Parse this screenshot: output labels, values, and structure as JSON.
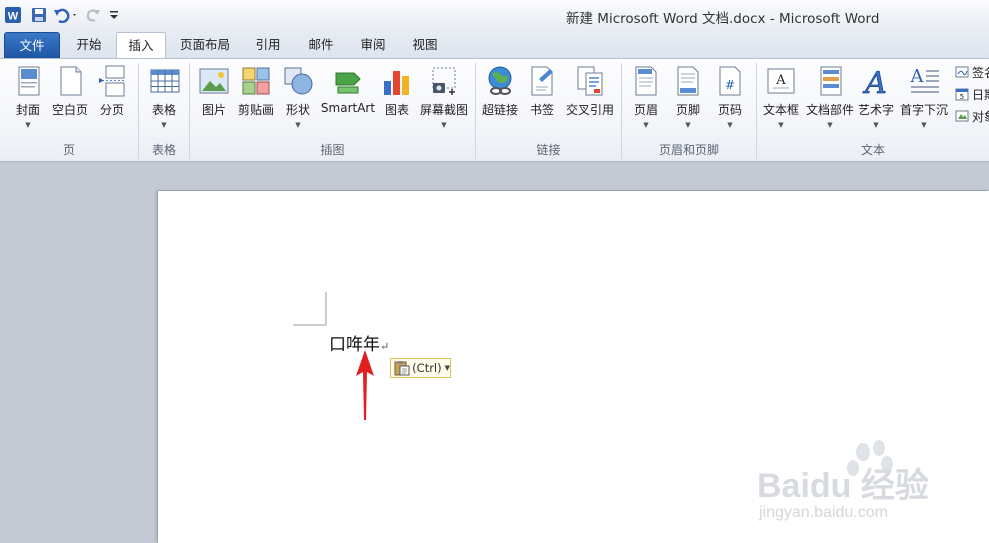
{
  "window": {
    "title": "新建 Microsoft Word 文档.docx  -  Microsoft Word"
  },
  "quick_access": {
    "icons": [
      "word-logo-icon",
      "save-icon",
      "undo-icon",
      "redo-icon",
      "customize-icon"
    ]
  },
  "tabs": [
    {
      "label": "文件"
    },
    {
      "label": "开始"
    },
    {
      "label": "插入"
    },
    {
      "label": "页面布局"
    },
    {
      "label": "引用"
    },
    {
      "label": "邮件"
    },
    {
      "label": "审阅"
    },
    {
      "label": "视图"
    }
  ],
  "ribbon": {
    "buttons": [
      {
        "label": "封面"
      },
      {
        "label": "空白页"
      },
      {
        "label": "分页"
      },
      {
        "label": "表格"
      },
      {
        "label": "图片"
      },
      {
        "label": "剪贴画"
      },
      {
        "label": "形状"
      },
      {
        "label": "SmartArt"
      },
      {
        "label": "图表"
      },
      {
        "label": "屏幕截图"
      },
      {
        "label": "超链接"
      },
      {
        "label": "书签"
      },
      {
        "label": "交叉引用"
      },
      {
        "label": "页眉"
      },
      {
        "label": "页脚"
      },
      {
        "label": "页码"
      },
      {
        "label": "文本框"
      },
      {
        "label": "文档部件"
      },
      {
        "label": "艺术字"
      },
      {
        "label": "首字下沉"
      }
    ],
    "small_buttons": [
      {
        "label": "签名"
      },
      {
        "label": "日期"
      },
      {
        "label": "对象"
      }
    ],
    "groups": [
      {
        "label": "页"
      },
      {
        "label": "表格"
      },
      {
        "label": "插图"
      },
      {
        "label": "链接"
      },
      {
        "label": "页眉和页脚"
      },
      {
        "label": "文本"
      }
    ]
  },
  "document": {
    "text": "口哖年",
    "paragraph_mark": "↵",
    "paste_options_label": "(Ctrl)"
  },
  "watermark": {
    "brand": "Baidu 经验",
    "url": "jingyan.baidu.com"
  },
  "colors": {
    "file_tab": "#2b63b4",
    "arrow": "#e02020",
    "paste_border": "#e0c35a"
  }
}
